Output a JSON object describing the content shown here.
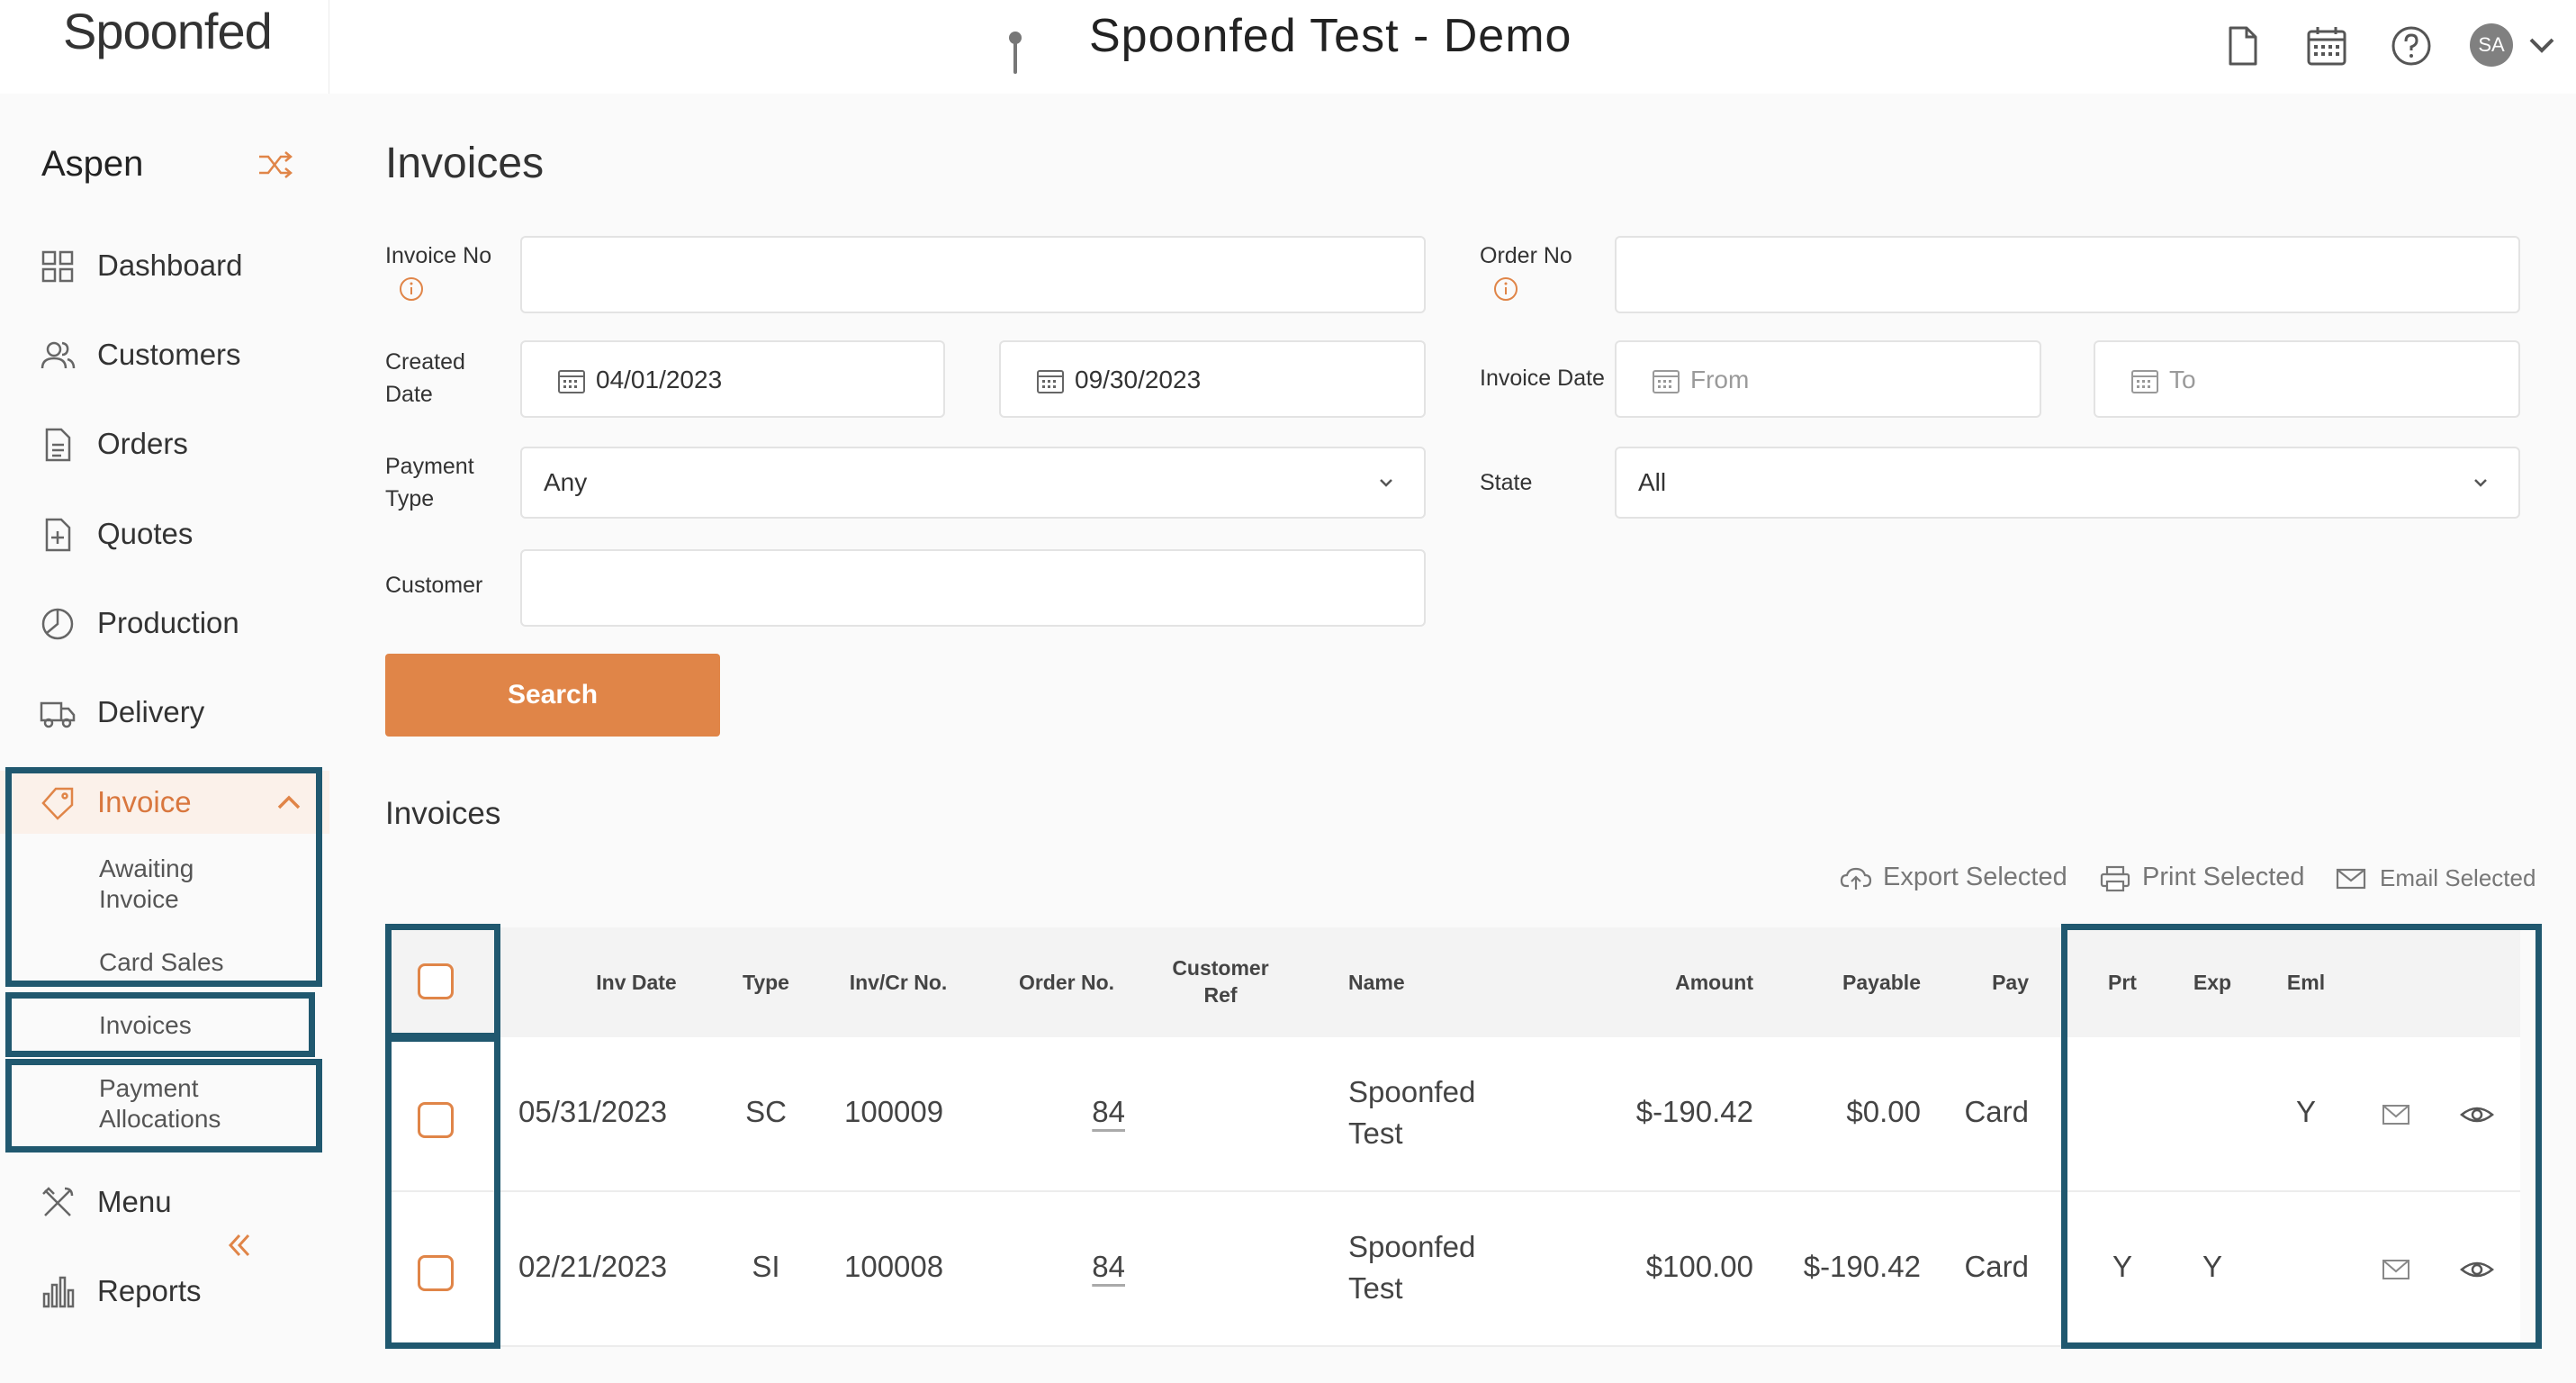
{
  "header": {
    "logo_text": "Spoonfed",
    "title": "Spoonfed Test - Demo",
    "icons": [
      "document-icon",
      "calendar-icon",
      "help-icon"
    ],
    "avatar_initials": "SA"
  },
  "sidebar": {
    "brand": "Aspen",
    "items": [
      {
        "label": "Dashboard",
        "icon": "grid-icon"
      },
      {
        "label": "Customers",
        "icon": "users-icon"
      },
      {
        "label": "Orders",
        "icon": "document-icon"
      },
      {
        "label": "Quotes",
        "icon": "document-plus-icon"
      },
      {
        "label": "Production",
        "icon": "pie-icon"
      },
      {
        "label": "Delivery",
        "icon": "truck-icon"
      },
      {
        "label": "Invoice",
        "icon": "tag-icon"
      },
      {
        "label": "Menu",
        "icon": "utensils-icon"
      },
      {
        "label": "Reports",
        "icon": "bar-chart-icon"
      }
    ],
    "invoice_sub": {
      "awaiting_1": "Awaiting",
      "awaiting_2": "Invoice",
      "card_sales": "Card Sales",
      "invoices": "Invoices",
      "payment_1": "Payment",
      "payment_2": "Allocations"
    }
  },
  "main": {
    "title": "Invoices",
    "filters": {
      "invoice_no_label": "Invoice No",
      "order_no_label": "Order No",
      "created_date_label_1": "Created",
      "created_date_label_2": "Date",
      "created_from": "04/01/2023",
      "created_to": "09/30/2023",
      "invoice_date_label": "Invoice Date",
      "invoice_date_from_ph": "From",
      "invoice_date_to_ph": "To",
      "payment_type_label_1": "Payment",
      "payment_type_label_2": "Type",
      "payment_type_value": "Any",
      "state_label": "State",
      "state_value": "All",
      "customer_label": "Customer"
    },
    "search_label": "Search",
    "section_title": "Invoices",
    "actions": {
      "export": "Export Selected",
      "print": "Print Selected",
      "email": "Email Selected"
    }
  },
  "table": {
    "headers": {
      "inv_date": "Inv Date",
      "type": "Type",
      "inv_no": "Inv/Cr No.",
      "order_no": "Order No.",
      "cust_ref_1": "Customer",
      "cust_ref_2": "Ref",
      "name": "Name",
      "amount": "Amount",
      "payable": "Payable",
      "pay": "Pay",
      "prt": "Prt",
      "exp": "Exp",
      "eml": "Eml"
    },
    "rows": [
      {
        "inv_date": "05/31/2023",
        "type": "SC",
        "inv_no": "100009",
        "order_no": "84",
        "name_1": "Spoonfed",
        "name_2": "Test",
        "amount": "$-190.42",
        "payable": "$0.00",
        "pay": "Card",
        "prt": "",
        "exp": "",
        "eml": "Y"
      },
      {
        "inv_date": "02/21/2023",
        "type": "SI",
        "inv_no": "100008",
        "order_no": "84",
        "name_1": "Spoonfed",
        "name_2": "Test",
        "amount": "$100.00",
        "payable": "$-190.42",
        "pay": "Card",
        "prt": "Y",
        "exp": "Y",
        "eml": ""
      }
    ]
  },
  "colors": {
    "accent": "#e08548",
    "highlight": "#20586f",
    "sidebar_bg": "#fafafa"
  }
}
